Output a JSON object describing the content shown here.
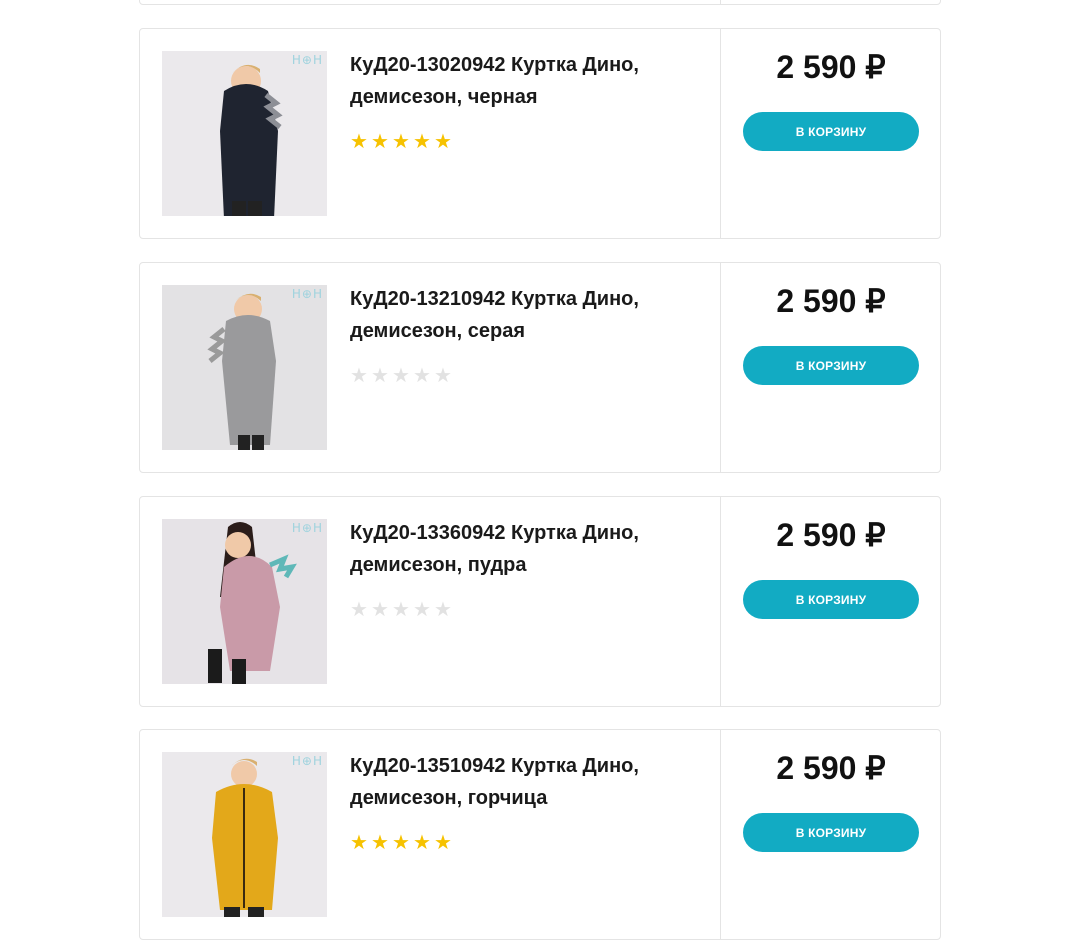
{
  "products": [
    {
      "title": "КуД20-13020942 Куртка Дино, демисезон, черная",
      "price": "2 590 ₽",
      "rating": 5,
      "button_label": "В КОРЗИНУ",
      "watermark": "Н⊕Н",
      "coat_color": "#1f2430",
      "stars": [
        "★",
        "★",
        "★",
        "★",
        "★"
      ]
    },
    {
      "title": "КуД20-13210942 Куртка Дино, демисезон, серая",
      "price": "2 590 ₽",
      "rating": 0,
      "button_label": "В КОРЗИНУ",
      "watermark": "Н⊕Н",
      "coat_color": "#9a9a9c",
      "stars": [
        "★",
        "★",
        "★",
        "★",
        "★"
      ]
    },
    {
      "title": "КуД20-13360942 Куртка Дино, демисезон, пудра",
      "price": "2 590 ₽",
      "rating": 0,
      "button_label": "В КОРЗИНУ",
      "watermark": "Н⊕Н",
      "coat_color": "#c99aa8",
      "stars": [
        "★",
        "★",
        "★",
        "★",
        "★"
      ]
    },
    {
      "title": "КуД20-13510942 Куртка Дино, демисезон, горчица",
      "price": "2 590 ₽",
      "rating": 5,
      "button_label": "В КОРЗИНУ",
      "watermark": "Н⊕Н",
      "coat_color": "#e3a81a",
      "stars": [
        "★",
        "★",
        "★",
        "★",
        "★"
      ]
    }
  ],
  "colors": {
    "accent": "#12abc3",
    "star_on": "#f6c200",
    "star_off": "#e2e2e2",
    "border": "#e4e4e4"
  }
}
